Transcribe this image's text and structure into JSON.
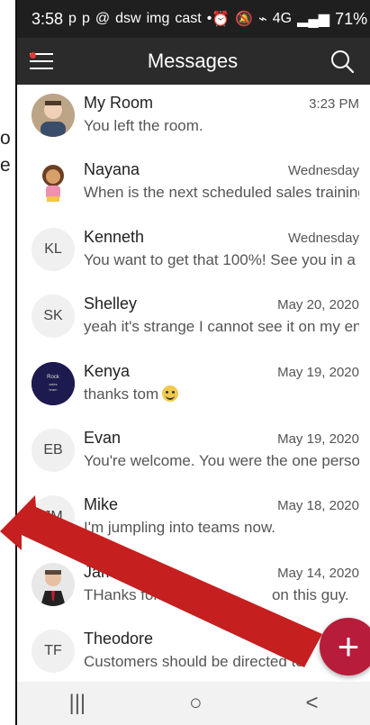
{
  "status_bar": {
    "time": "3:58",
    "battery": "71%",
    "icons_left": [
      "p",
      "p",
      "@",
      "dsw",
      "img",
      "cast",
      "•"
    ],
    "icons_right": [
      "alarm",
      "mute",
      "wifi",
      "4G",
      "signal",
      "battery"
    ]
  },
  "header": {
    "title": "Messages"
  },
  "left_fragments": [
    "o",
    "e"
  ],
  "messages": [
    {
      "name": "My Room",
      "time": "3:23 PM",
      "preview": "You left the room.",
      "avatar": "photo"
    },
    {
      "name": "Nayana",
      "time": "Wednesday",
      "preview": "When is the next scheduled sales training",
      "avatar": "dora"
    },
    {
      "name": "Kenneth",
      "time": "Wednesday",
      "preview": "You want to get that 100%! See you in a",
      "avatar": "KL"
    },
    {
      "name": "Shelley",
      "time": "May 20, 2020",
      "preview": "yeah it's strange I cannot see it on my end,",
      "avatar": "SK"
    },
    {
      "name": "Kenya",
      "time": "May 19, 2020",
      "preview": "thanks tom",
      "avatar": "dark"
    },
    {
      "name": "Evan",
      "time": "May 19, 2020",
      "preview": "You're welcome. You were the one person",
      "avatar": "EB"
    },
    {
      "name": "Mike",
      "time": "May 18, 2020",
      "preview": "I'm jumpling into teams now.",
      "avatar": "JM"
    },
    {
      "name": "James",
      "time": "May 14, 2020",
      "preview": "THanks for the",
      "preview2": "on this guy.",
      "avatar": "photo2"
    },
    {
      "name": "Theodore",
      "time": "",
      "preview": "Customers should be directed to",
      "avatar": "TF"
    }
  ],
  "fab": {
    "label": "+"
  },
  "nav": {
    "recent": "|||",
    "home": "○",
    "back": "<"
  }
}
